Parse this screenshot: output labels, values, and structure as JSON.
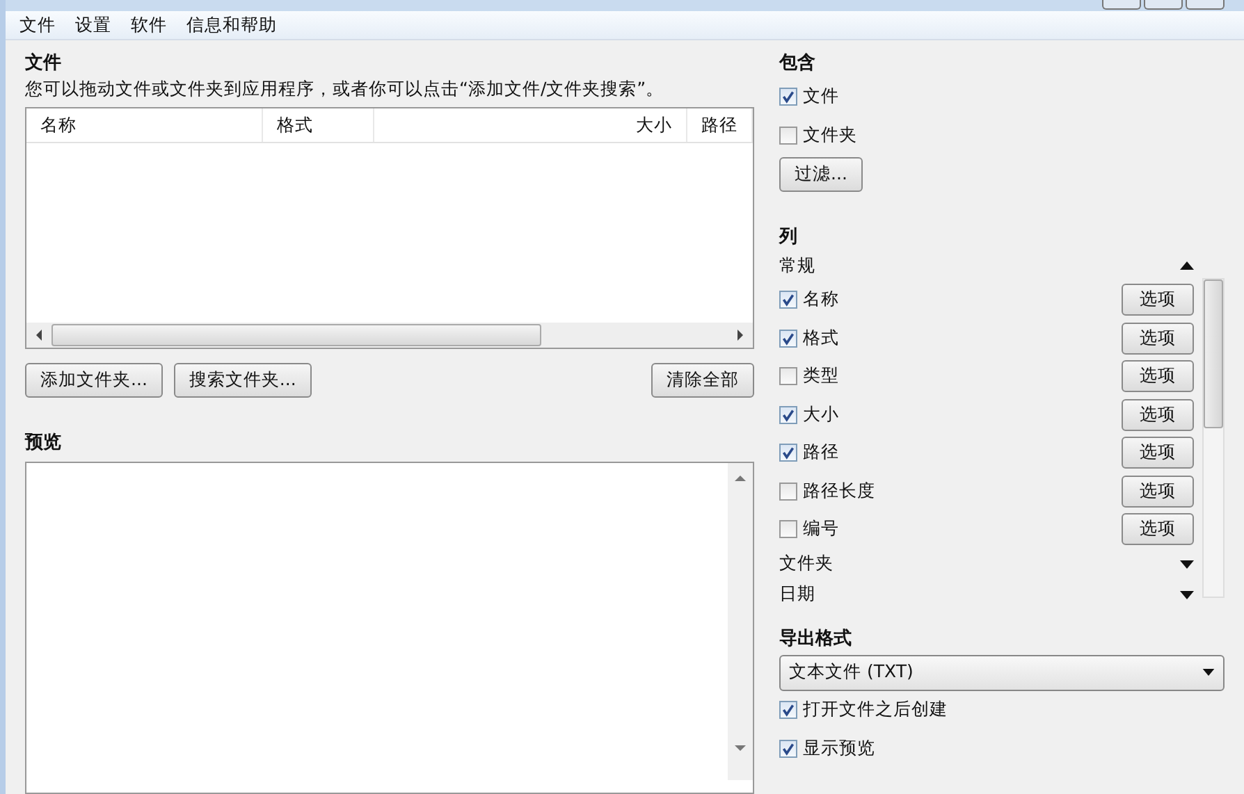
{
  "menu": [
    "文件",
    "设置",
    "软件",
    "信息和帮助"
  ],
  "files": {
    "heading": "文件",
    "hint": "您可以拖动文件或文件夹到应用程序，或者你可以点击“添加文件/文件夹搜索”。",
    "columns": [
      "名称",
      "格式",
      "大小",
      "路径"
    ],
    "buttons": [
      "添加文件夹...",
      "搜索文件夹..."
    ],
    "clear_button": "清除全部"
  },
  "preview": {
    "heading": "预览"
  },
  "include": {
    "heading": "包含",
    "options": [
      {
        "label": "文件",
        "checked": true
      },
      {
        "label": "文件夹",
        "checked": false
      }
    ],
    "filter_button": "过滤..."
  },
  "columns_panel": {
    "heading": "列",
    "groups": [
      {
        "label": "常规",
        "expanded": true,
        "items": [
          {
            "label": "名称",
            "checked": true,
            "button": "选项"
          },
          {
            "label": "格式",
            "checked": true,
            "button": "选项"
          },
          {
            "label": "类型",
            "checked": false,
            "button": "选项"
          },
          {
            "label": "大小",
            "checked": true,
            "button": "选项"
          },
          {
            "label": "路径",
            "checked": true,
            "button": "选项"
          },
          {
            "label": "路径长度",
            "checked": false,
            "button": "选项"
          },
          {
            "label": "编号",
            "checked": false,
            "button": "选项"
          }
        ]
      },
      {
        "label": "文件夹",
        "expanded": false
      },
      {
        "label": "日期",
        "expanded": false
      }
    ]
  },
  "export": {
    "heading": "导出格式",
    "format": "文本文件 (TXT)",
    "options": [
      {
        "label": "打开文件之后创建",
        "checked": true
      },
      {
        "label": "显示预览",
        "checked": true
      }
    ]
  }
}
